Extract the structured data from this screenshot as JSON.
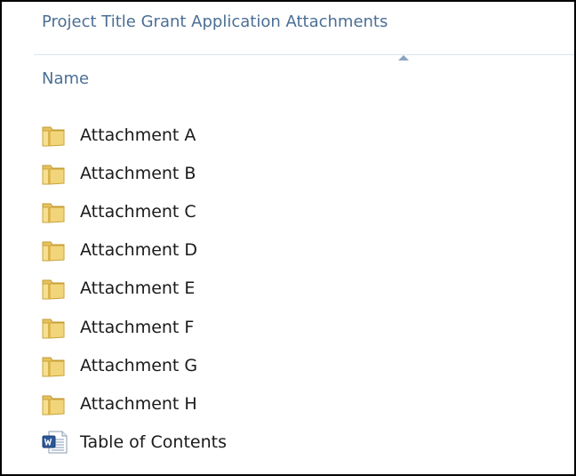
{
  "window": {
    "breadcrumb": "Project Title Grant Application Attachments"
  },
  "columns": {
    "name_label": "Name",
    "sort_direction": "ascending"
  },
  "items": [
    {
      "label": "Attachment A",
      "type": "folder",
      "icon": "folder-icon"
    },
    {
      "label": "Attachment B",
      "type": "folder",
      "icon": "folder-icon"
    },
    {
      "label": "Attachment C",
      "type": "folder",
      "icon": "folder-icon"
    },
    {
      "label": "Attachment D",
      "type": "folder",
      "icon": "folder-icon"
    },
    {
      "label": "Attachment E",
      "type": "folder",
      "icon": "folder-icon"
    },
    {
      "label": "Attachment F",
      "type": "folder",
      "icon": "folder-icon"
    },
    {
      "label": "Attachment G",
      "type": "folder",
      "icon": "folder-icon"
    },
    {
      "label": "Attachment H",
      "type": "folder",
      "icon": "folder-icon"
    },
    {
      "label": "Table of Contents",
      "type": "word-document",
      "icon": "word-document-icon"
    }
  ],
  "colors": {
    "header_text": "#4b6f94",
    "folder_light": "#f7e59a",
    "folder_dark": "#d9b346",
    "word_blue": "#2b5797"
  }
}
